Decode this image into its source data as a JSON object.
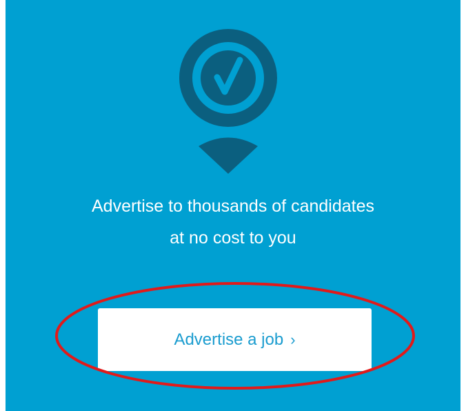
{
  "colors": {
    "panel_background": "#00a0d2",
    "pin_dark": "#0b5f7f",
    "button_text": "#1a9ccf",
    "annotation_circle": "#e11a1a"
  },
  "icon": {
    "name": "location-pin-checkmark-icon"
  },
  "headline": {
    "line1": "Advertise to thousands of candidates",
    "line2": "at no cost to you"
  },
  "cta": {
    "label": "Advertise a job",
    "chevron": "›"
  }
}
